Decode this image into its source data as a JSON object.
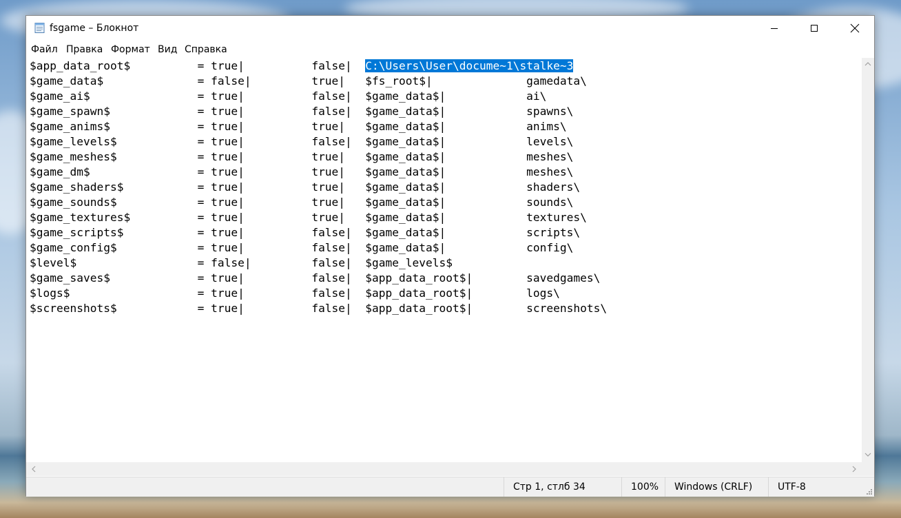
{
  "window": {
    "title": "fsgame – Блокнот",
    "icon": "notepad-icon"
  },
  "menu": [
    "Файл",
    "Правка",
    "Формат",
    "Вид",
    "Справка"
  ],
  "editor": {
    "lines": [
      "$app_data_root$          = true|          false|  ",
      "$game_data$              = false|         true|   $fs_root$|              gamedata\\",
      "$game_ai$                = true|          false|  $game_data$|            ai\\",
      "$game_spawn$             = true|          false|  $game_data$|            spawns\\",
      "$game_anims$             = true|          true|   $game_data$|            anims\\",
      "$game_levels$            = true|          false|  $game_data$|            levels\\",
      "$game_meshes$            = true|          true|   $game_data$|            meshes\\",
      "$game_dm$                = true|          true|   $game_data$|            meshes\\",
      "$game_shaders$           = true|          true|   $game_data$|            shaders\\",
      "$game_sounds$            = true|          true|   $game_data$|            sounds\\",
      "$game_textures$          = true|          true|   $game_data$|            textures\\",
      "$game_scripts$           = true|          false|  $game_data$|            scripts\\",
      "$game_config$            = true|          false|  $game_data$|            config\\",
      "$level$                  = false|         false|  $game_levels$",
      "$game_saves$             = true|          false|  $app_data_root$|        savedgames\\",
      "$logs$                   = true|          false|  $app_data_root$|        logs\\",
      "$screenshots$            = true|          false|  $app_data_root$|        screenshots\\"
    ],
    "selected_text": "C:\\Users\\User\\docume~1\\stalke~3"
  },
  "status": {
    "position": "Стр 1, стлб 34",
    "zoom": "100%",
    "line_endings": "Windows (CRLF)",
    "encoding": "UTF-8"
  }
}
